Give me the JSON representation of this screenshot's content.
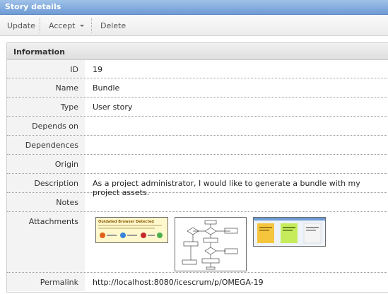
{
  "window": {
    "title": "Story details"
  },
  "toolbar": {
    "update_label": "Update",
    "accept_label": "Accept",
    "delete_label": "Delete"
  },
  "panel": {
    "title": "Information"
  },
  "fields": {
    "id": {
      "label": "ID",
      "value": "19"
    },
    "name": {
      "label": "Name",
      "value": "Bundle"
    },
    "type": {
      "label": "Type",
      "value": "User story"
    },
    "depends_on": {
      "label": "Depends on",
      "value": ""
    },
    "dependences": {
      "label": "Dependences",
      "value": ""
    },
    "origin": {
      "label": "Origin",
      "value": ""
    },
    "description": {
      "label": "Description",
      "value": "As a project administrator, I would like to generate a bundle with my project assets."
    },
    "notes": {
      "label": "Notes",
      "value": ""
    },
    "attachments": {
      "label": "Attachments"
    },
    "permalink": {
      "label": "Permalink",
      "value": "http://localhost:8080/icescrum/p/OMEGA-19"
    }
  },
  "attachments": [
    {
      "icon": "browser-warning-screenshot",
      "title": "Outdated Browser Detected"
    },
    {
      "icon": "flowchart-diagram"
    },
    {
      "icon": "sticky-notes-board"
    }
  ],
  "colors": {
    "titlebar": "#7ea8dc",
    "label_bg": "#f3f3f3"
  }
}
